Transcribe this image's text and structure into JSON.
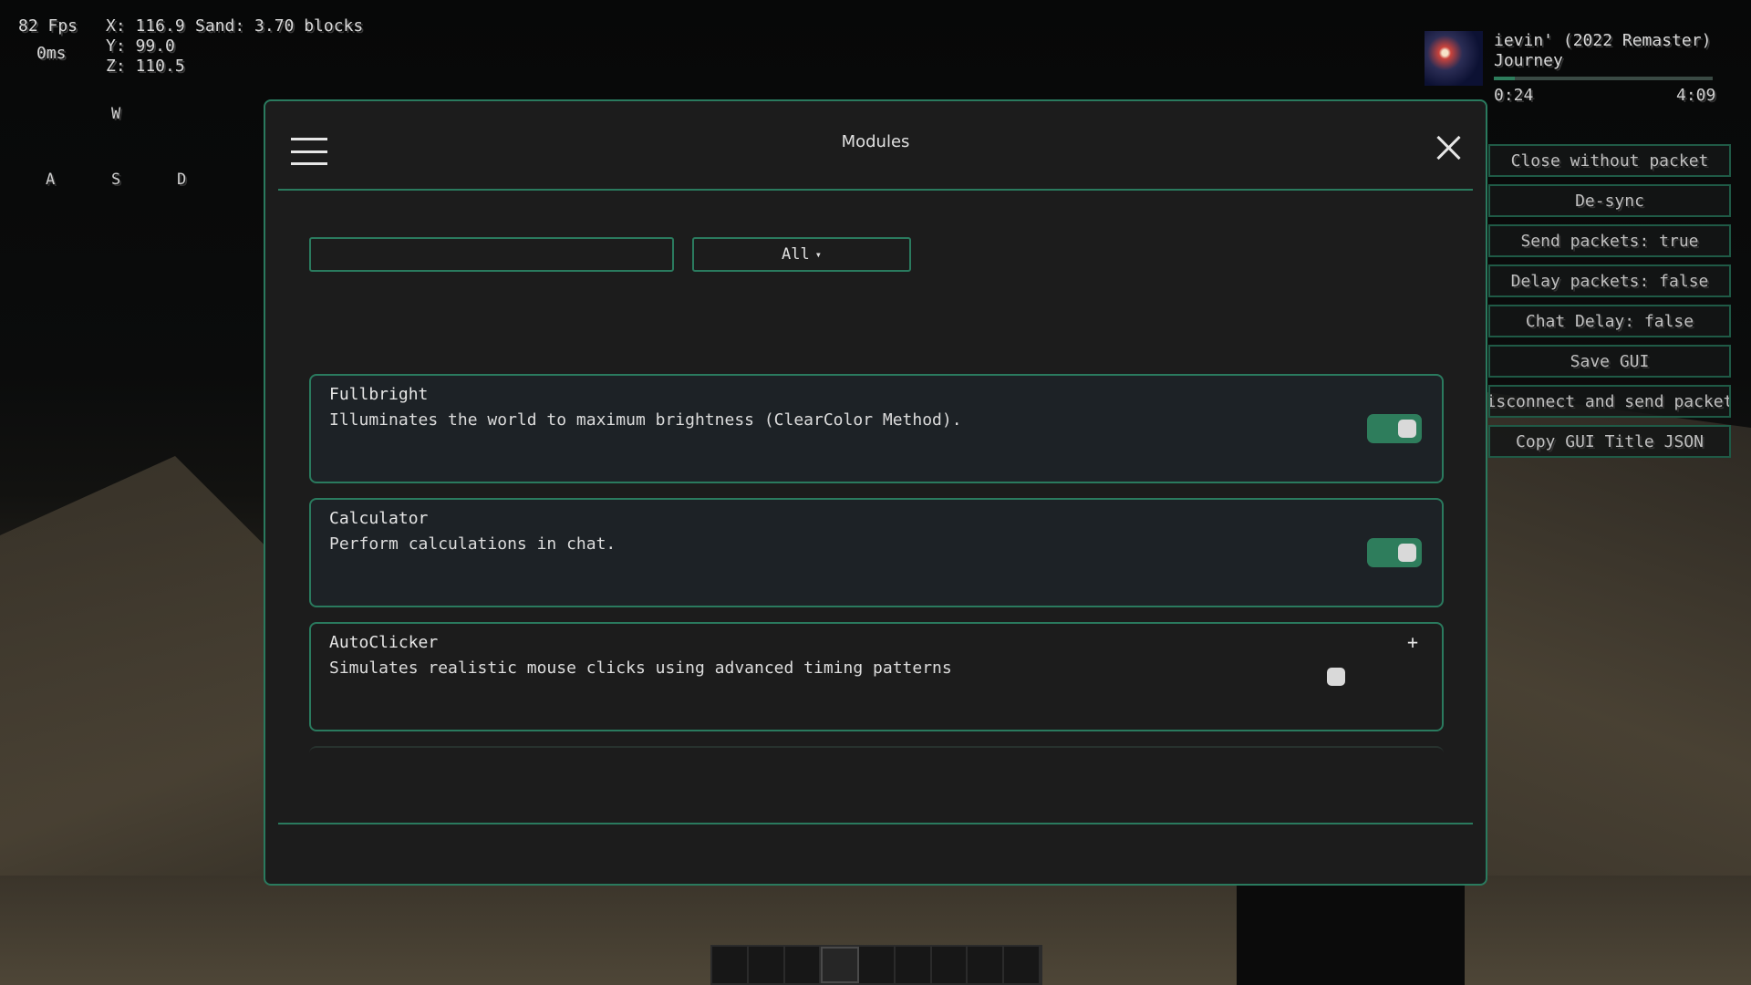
{
  "hud": {
    "fps": "82 Fps",
    "ping": "0ms",
    "x": "X: 116.9",
    "y": "Y: 99.0",
    "z": "Z: 110.5",
    "sand": "Sand: 3.70 blocks",
    "keys": {
      "w": "W",
      "a": "A",
      "s": "S",
      "d": "D"
    }
  },
  "music": {
    "title": "ievin' (2022 Remaster)",
    "artist": "Journey",
    "elapsed": "0:24",
    "duration": "4:09",
    "progress_fraction": 0.096
  },
  "side_buttons": [
    "Close without packet",
    "De-sync",
    "Send packets: true",
    "Delay packets: false",
    "Chat Delay: false",
    "Save GUI",
    "Disconnect and send packets",
    "Copy GUI Title JSON"
  ],
  "window": {
    "title": "Modules",
    "search_value": "",
    "filter_label": "All",
    "filter_caret": "▾"
  },
  "modules": [
    {
      "name": "Fullbright",
      "description": "Illuminates the world to maximum brightness (ClearColor Method).",
      "enabled": true
    },
    {
      "name": "Calculator",
      "description": "Perform calculations in chat.",
      "enabled": true
    },
    {
      "name": "AutoClicker",
      "description": "Simulates realistic mouse clicks using advanced timing patterns",
      "enabled": false,
      "expand_label": "+"
    }
  ],
  "colors": {
    "accent": "#2a7a5e",
    "toggle_on": "#2e7d5c",
    "panel": "#1c1c1c",
    "card": "#1d2226"
  },
  "hotbar": {
    "slots": 9,
    "selected_slot": 4
  }
}
